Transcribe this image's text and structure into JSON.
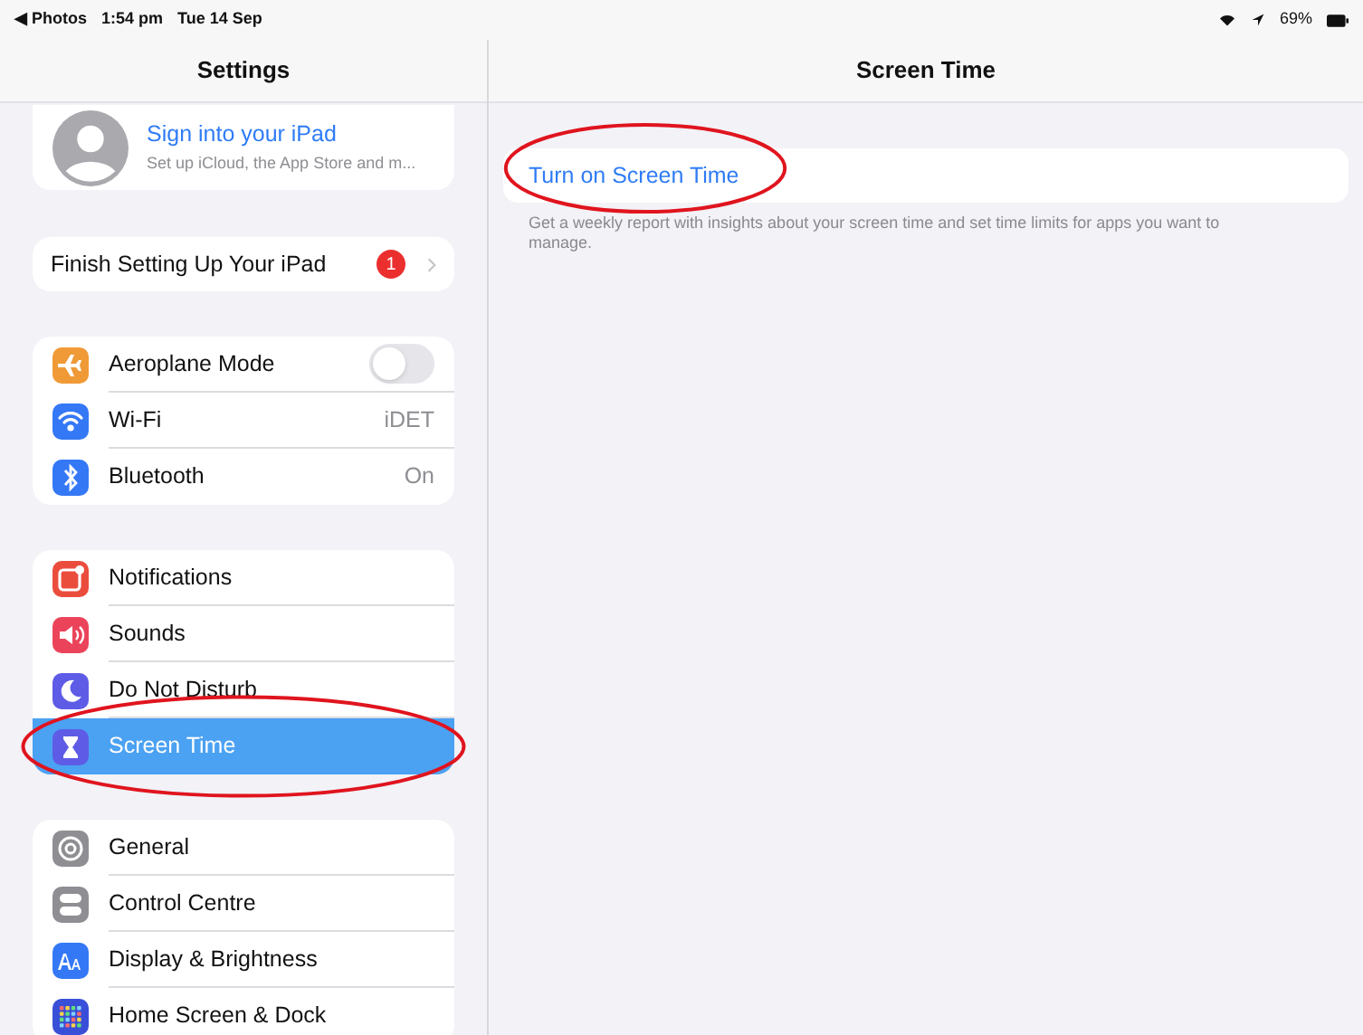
{
  "status_bar": {
    "back": "◀ Photos",
    "time": "1:54 pm",
    "date": "Tue 14 Sep",
    "battery": "69%"
  },
  "sidebar": {
    "title": "Settings",
    "profile": {
      "title": "Sign into your iPad",
      "subtitle": "Set up iCloud, the App Store and m..."
    },
    "setup": {
      "label": "Finish Setting Up Your iPad",
      "badge": "1"
    },
    "groups": [
      {
        "items": [
          {
            "label": "Aeroplane Mode",
            "color": "#f09a37",
            "kind": "toggle",
            "on": false,
            "selected": false,
            "circled": false
          },
          {
            "label": "Wi-Fi",
            "color": "#3478f6",
            "kind": "value",
            "value": "iDET",
            "selected": false,
            "circled": false
          },
          {
            "label": "Bluetooth",
            "color": "#3478f6",
            "kind": "value",
            "value": "On",
            "selected": false,
            "circled": false
          }
        ]
      },
      {
        "items": [
          {
            "label": "Notifications",
            "color": "#eb4d3d",
            "kind": "plain",
            "selected": false,
            "circled": false
          },
          {
            "label": "Sounds",
            "color": "#eb445a",
            "kind": "plain",
            "selected": false,
            "circled": false
          },
          {
            "label": "Do Not Disturb",
            "color": "#5e5ce6",
            "kind": "plain",
            "selected": false,
            "circled": false
          },
          {
            "label": "Screen Time",
            "color": "#5e5ce6",
            "kind": "plain",
            "selected": true,
            "circled": true
          }
        ]
      },
      {
        "items": [
          {
            "label": "General",
            "color": "#8e8e93",
            "kind": "plain",
            "selected": false,
            "circled": false
          },
          {
            "label": "Control Centre",
            "color": "#8e8e93",
            "kind": "plain",
            "selected": false,
            "circled": false
          },
          {
            "label": "Display & Brightness",
            "color": "#3478f6",
            "kind": "plain",
            "selected": false,
            "circled": false
          },
          {
            "label": "Home Screen & Dock",
            "color": "#3a4fd8",
            "kind": "plain",
            "selected": false,
            "circled": false
          }
        ]
      }
    ]
  },
  "detail": {
    "title": "Screen Time",
    "button": {
      "label": "Turn on Screen Time",
      "circled": true
    },
    "description": "Get a weekly report with insights about your screen time and set time limits for apps you want to manage."
  }
}
